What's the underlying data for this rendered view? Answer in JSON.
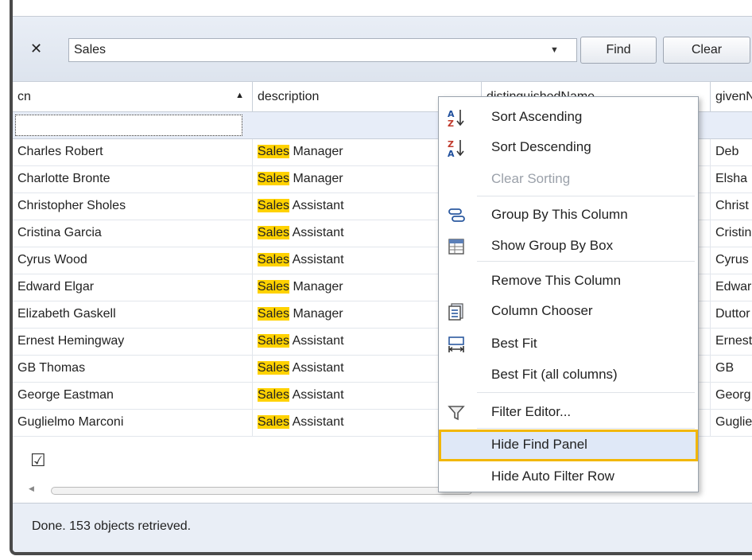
{
  "find_panel": {
    "close_label": "✕",
    "search_value": "Sales",
    "find_label": "Find",
    "clear_label": "Clear"
  },
  "grid": {
    "columns": [
      "cn",
      "description",
      "distinguishedName",
      "givenName"
    ],
    "sort_indicator": "▲",
    "highlight": "Sales",
    "rows": [
      {
        "cn": "Charles Robert",
        "desc_rest": " Manager",
        "given": "Deb"
      },
      {
        "cn": "Charlotte Bronte",
        "desc_rest": " Manager",
        "given": "Elsha"
      },
      {
        "cn": "Christopher Sholes",
        "desc_rest": " Assistant",
        "given": "Christ"
      },
      {
        "cn": "Cristina Garcia",
        "desc_rest": " Assistant",
        "given": "Cristin"
      },
      {
        "cn": "Cyrus Wood",
        "desc_rest": " Assistant",
        "given": "Cyrus"
      },
      {
        "cn": "Edward Elgar",
        "desc_rest": " Manager",
        "given": "Edwar"
      },
      {
        "cn": "Elizabeth Gaskell",
        "desc_rest": " Manager",
        "given": "Duttor"
      },
      {
        "cn": "Ernest Hemingway",
        "desc_rest": " Assistant",
        "given": "Ernest"
      },
      {
        "cn": "GB Thomas",
        "desc_rest": " Assistant",
        "given": "GB"
      },
      {
        "cn": "George Eastman",
        "desc_rest": " Assistant",
        "given": "Georg"
      },
      {
        "cn": "Guglielmo Marconi",
        "desc_rest": " Assistant",
        "given": "Guglie"
      }
    ]
  },
  "footer": {
    "check_glyph": "☑"
  },
  "status": {
    "text": "Done. 153 objects retrieved."
  },
  "context_menu": {
    "items": [
      {
        "label": "Sort Ascending",
        "icon": "sort-ascending-icon"
      },
      {
        "label": "Sort Descending",
        "icon": "sort-descending-icon"
      },
      {
        "label": "Clear Sorting",
        "icon": "",
        "disabled": true
      },
      {
        "label": "Group By This Column",
        "icon": "group-by-icon"
      },
      {
        "label": "Show Group By Box",
        "icon": "group-box-icon"
      },
      {
        "label": "Remove This Column",
        "icon": ""
      },
      {
        "label": "Column Chooser",
        "icon": "column-chooser-icon"
      },
      {
        "label": "Best Fit",
        "icon": "best-fit-icon"
      },
      {
        "label": "Best Fit (all columns)",
        "icon": ""
      },
      {
        "label": "Filter Editor...",
        "icon": "filter-icon"
      },
      {
        "label": "Hide Find Panel",
        "icon": "",
        "selected": true
      },
      {
        "label": "Hide Auto Filter Row",
        "icon": ""
      }
    ]
  },
  "colors": {
    "highlight": "#ffd200",
    "selection_outline": "#f2b705",
    "panel_bg": "#e9eef6"
  }
}
